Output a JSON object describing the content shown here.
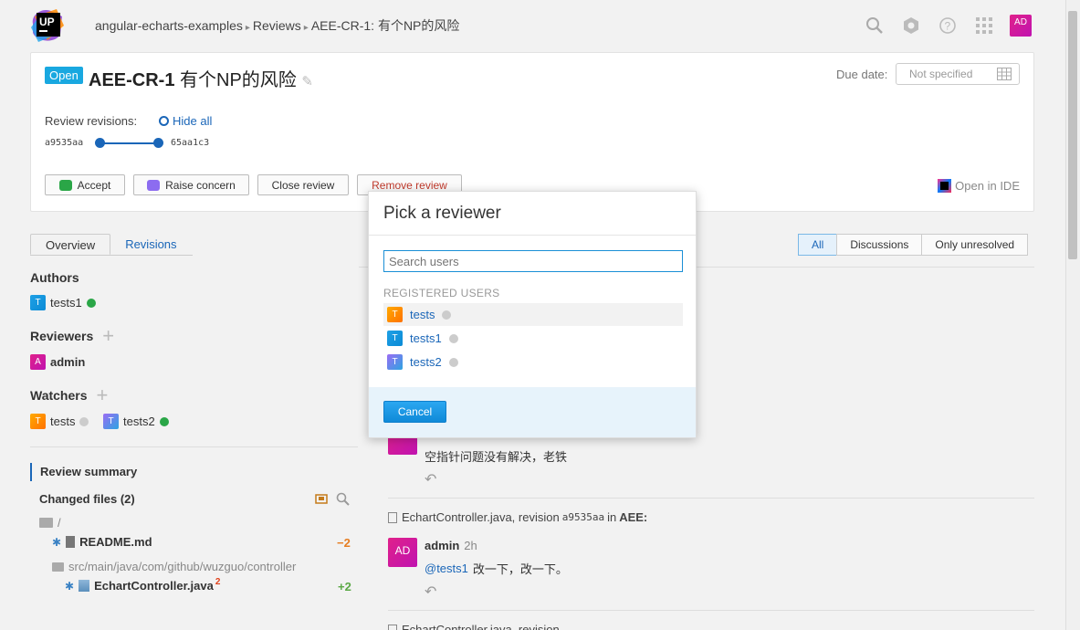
{
  "logo": {
    "text": "UP"
  },
  "breadcrumb": {
    "project": "angular-echarts-examples",
    "section": "Reviews",
    "review": "AEE-CR-1: 有个NP的风险",
    "separator": "▸"
  },
  "user_avatar": "AD",
  "review": {
    "status": "Open",
    "id": "AEE-CR-1",
    "title": "有个NP的风险",
    "due_label": "Due date:",
    "due_value": "Not specified",
    "revisions_label": "Review revisions:",
    "hide_all": "Hide all",
    "rev_from": "a9535aa",
    "rev_to": "65aa1c3",
    "actions": {
      "accept": "Accept",
      "raise": "Raise concern",
      "close": "Close review",
      "remove": "Remove review"
    },
    "open_ide": "Open in IDE"
  },
  "tabs": {
    "overview": "Overview",
    "revisions": "Revisions"
  },
  "filters": {
    "all": "All",
    "discussions": "Discussions",
    "unresolved": "Only unresolved"
  },
  "sidebar": {
    "authors_label": "Authors",
    "authors": [
      {
        "initial": "T",
        "name": "tests1"
      }
    ],
    "reviewers_label": "Reviewers",
    "reviewers": [
      {
        "initial": "A",
        "name": "admin"
      }
    ],
    "watchers_label": "Watchers",
    "watchers": [
      {
        "initial": "T",
        "name": "tests"
      },
      {
        "initial": "T",
        "name": "tests2"
      }
    ],
    "summary_label": "Review summary",
    "changed_files_label": "Changed files (2)",
    "root_dir": "/",
    "file1": {
      "name": "README.md",
      "delta": "−2"
    },
    "dir2": "src/main/java/com/github/wuzguo/controller",
    "file2": {
      "name": "EchartController.java",
      "sup": "2",
      "delta": "+2"
    }
  },
  "feed": {
    "msg1": "空指针问题没有解决，老铁",
    "file_line_prefix": "EchartController.java, revision",
    "file_rev": "a9535aa",
    "file_in": "in",
    "file_project": "AEE:",
    "author": "admin",
    "time": "2h",
    "mention": "@tests1",
    "msg2": "改一下，改一下。",
    "avatar": "AD"
  },
  "modal": {
    "title": "Pick a reviewer",
    "search_placeholder": "Search users",
    "section_label": "REGISTERED USERS",
    "users": [
      {
        "initial": "T",
        "name": "tests"
      },
      {
        "initial": "T",
        "name": "tests1"
      },
      {
        "initial": "T",
        "name": "tests2"
      }
    ],
    "cancel": "Cancel"
  }
}
